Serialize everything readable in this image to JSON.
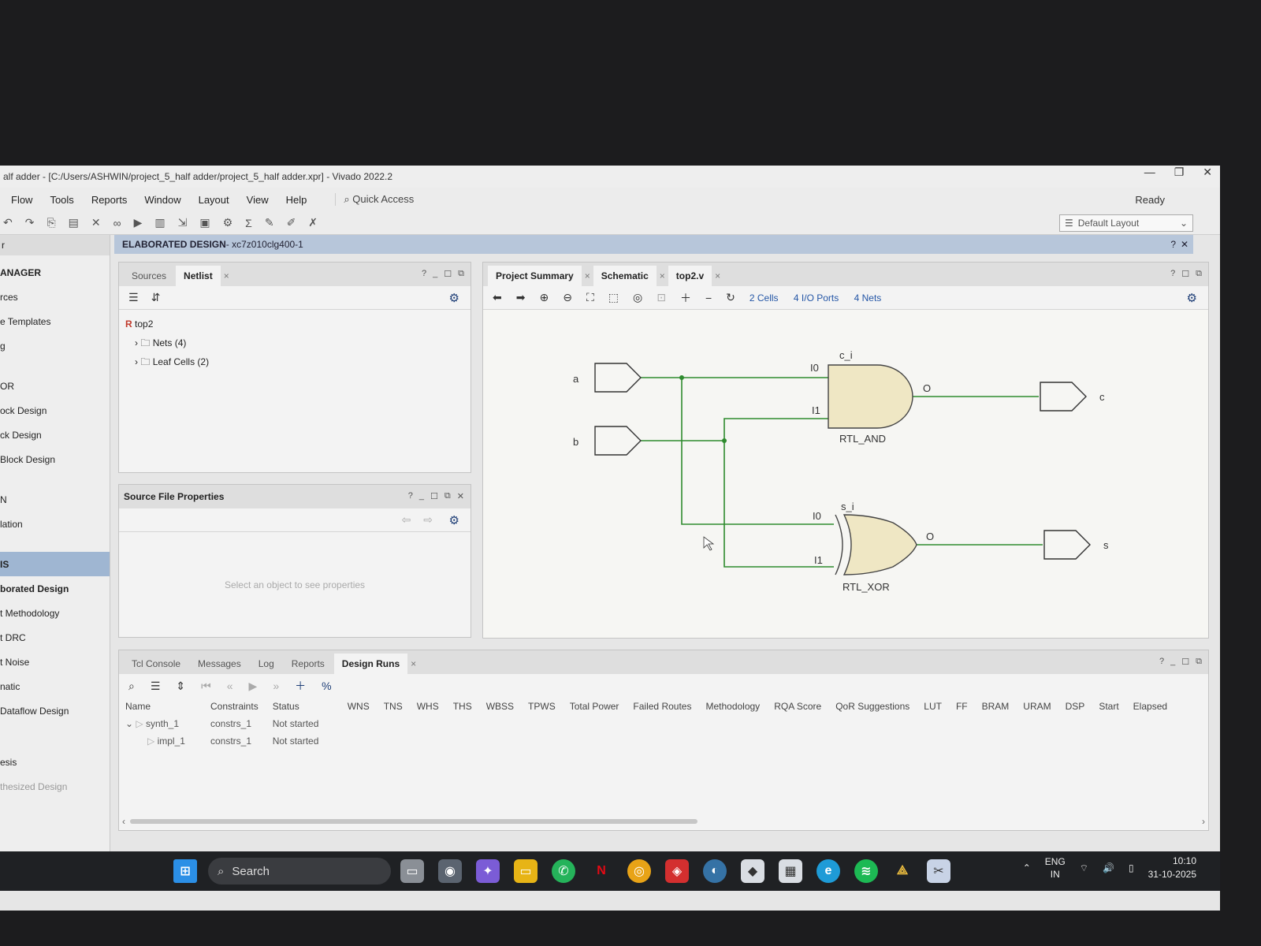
{
  "window": {
    "title": "alf adder - [C:/Users/ASHWIN/project_5_half adder/project_5_half adder.xpr] - Vivado 2022.2",
    "ready": "Ready",
    "layout": "Default Layout"
  },
  "menu": [
    "Flow",
    "Tools",
    "Reports",
    "Window",
    "Layout",
    "View",
    "Help"
  ],
  "quick_access": "Quick Access",
  "flow_nav": {
    "header": "ANAGER",
    "items": [
      "rces",
      "e Templates",
      "g",
      "OR",
      "ock Design",
      "ck Design",
      "Block Design",
      "N",
      "lation",
      "IS",
      "borated Design",
      "t Methodology",
      "t DRC",
      "t Noise",
      "natic",
      "Dataflow Design",
      "esis",
      "thesized Design"
    ]
  },
  "elab": {
    "title": "ELABORATED DESIGN",
    "part": " - xc7z010clg400-1"
  },
  "sources": {
    "tabs": [
      "Sources",
      "Netlist"
    ],
    "top": "top2",
    "nets": "Nets (4)",
    "leaf": "Leaf Cells (2)"
  },
  "sfp": {
    "title": "Source File Properties",
    "empty": "Select an object to see properties"
  },
  "schematic": {
    "tabs": [
      "Project Summary",
      "Schematic",
      "top2.v"
    ],
    "stats": {
      "cells": "2 Cells",
      "ports": "4 I/O Ports",
      "nets": "4 Nets"
    },
    "in_a": "a",
    "in_b": "b",
    "out_c": "c",
    "out_s": "s",
    "and": {
      "inst": "c_i",
      "type": "RTL_AND",
      "i0": "I0",
      "i1": "I1",
      "o": "O"
    },
    "xor": {
      "inst": "s_i",
      "type": "RTL_XOR",
      "i0": "I0",
      "i1": "I1",
      "o": "O"
    },
    "colors": {
      "gate": "#efe7c4",
      "wire": "#2e8b2e"
    }
  },
  "bottom": {
    "tabs": [
      "Tcl Console",
      "Messages",
      "Log",
      "Reports",
      "Design Runs"
    ],
    "columns": [
      "Name",
      "Constraints",
      "Status",
      "WNS",
      "TNS",
      "WHS",
      "THS",
      "WBSS",
      "TPWS",
      "Total Power",
      "Failed Routes",
      "Methodology",
      "RQA Score",
      "QoR Suggestions",
      "LUT",
      "FF",
      "BRAM",
      "URAM",
      "DSP",
      "Start",
      "Elapsed"
    ],
    "rows": [
      {
        "name": "synth_1",
        "constraints": "constrs_1",
        "status": "Not started"
      },
      {
        "name": "impl_1",
        "constraints": "constrs_1",
        "status": "Not started"
      }
    ]
  },
  "taskbar": {
    "search": "Search",
    "lang1": "ENG",
    "lang2": "IN",
    "time": "10:10",
    "date": "31-10-2025"
  }
}
